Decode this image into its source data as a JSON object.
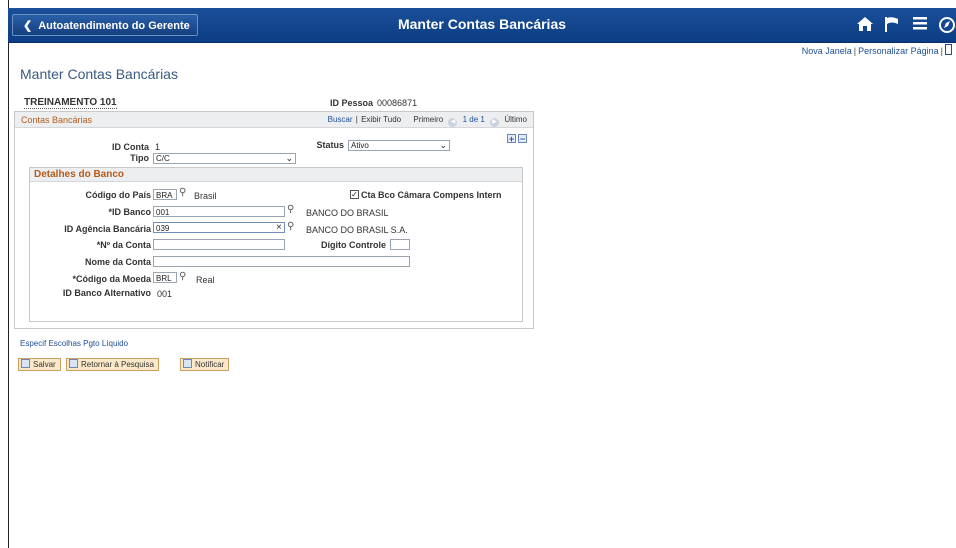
{
  "header": {
    "back_label": "Autoatendimento do Gerente",
    "title": "Manter Contas Bancárias",
    "icons": [
      "home-icon",
      "flag-icon",
      "menu-icon",
      "navbar-icon"
    ]
  },
  "links": {
    "new_window": "Nova Janela",
    "personalize": "Personalizar Página"
  },
  "page": {
    "title": "Manter Contas Bancárias"
  },
  "employee": {
    "name": "TREINAMENTO 101",
    "id_label": "ID Pessoa",
    "id_value": "00086871"
  },
  "grid": {
    "title": "Contas Bancárias",
    "search": "Buscar",
    "show_all": "Exibir Tudo",
    "first": "Primeiro",
    "counter": "1 de 1",
    "last": "Último",
    "account_id_label": "ID Conta",
    "account_id_value": "1",
    "status_label": "Status",
    "status_value": "Ativo",
    "type_label": "Tipo",
    "type_value": "C/C"
  },
  "bank": {
    "section_title": "Detalhes do Banco",
    "country_label": "Código do País",
    "country_value": "BRA",
    "country_desc": "Brasil",
    "clearing_label": "Cta Bco Câmara Compens Intern",
    "clearing_checked": true,
    "bank_id_label": "*ID Banco",
    "bank_id_value": "001",
    "bank_id_desc": "BANCO DO BRASIL",
    "branch_label": "ID Agência Bancária",
    "branch_value": "039",
    "branch_desc": "BANCO DO BRASIL S.A.",
    "account_no_label": "*Nº da Conta",
    "account_no_value": "",
    "check_digit_label": "Dígito Controle",
    "check_digit_value": "",
    "account_name_label": "Nome da Conta",
    "account_name_value": "",
    "currency_label": "*Código da Moeda",
    "currency_value": "BRL",
    "currency_desc": "Real",
    "alt_bank_label": "ID Banco Alternativo",
    "alt_bank_value": "001"
  },
  "footer": {
    "payment_link": "Especif Escolhas Pgto Líquido",
    "save": "Salvar",
    "return": "Retornar à Pesquisa",
    "notify": "Notificar"
  }
}
